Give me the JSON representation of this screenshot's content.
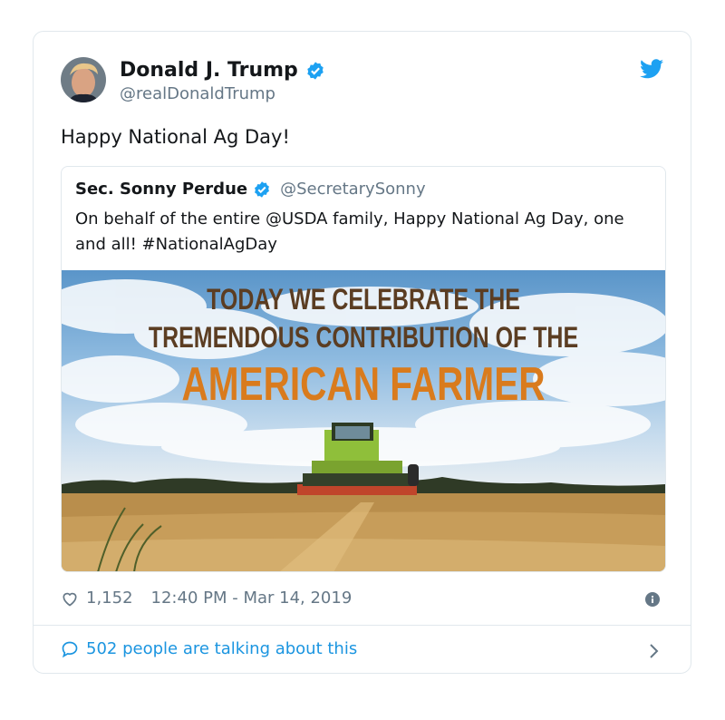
{
  "tweet": {
    "author_name": "Donald J. Trump",
    "author_handle": "@realDonaldTrump",
    "text": "Happy National Ag Day!",
    "likes": "1,152",
    "timestamp": "12:40 PM - Mar 14, 2019",
    "talking": "502 people are talking about this"
  },
  "quote": {
    "author_name": "Sec. Sonny Perdue",
    "author_handle": "@SecretarySonny",
    "text": "On behalf of the entire @USDA family, Happy National Ag Day, one and all! #NationalAgDay",
    "image_lines": [
      "TODAY WE CELEBRATE THE",
      "TREMENDOUS CONTRIBUTION OF THE",
      "AMERICAN FARMER"
    ]
  },
  "icons": {
    "verified": "verified-badge-icon",
    "bird": "twitter-bird-icon",
    "heart": "heart-icon",
    "info": "info-icon",
    "bubble": "speech-bubble-icon",
    "chevron": "chevron-right-icon"
  },
  "colors": {
    "twitter_blue": "#1da1f2",
    "link_blue": "#1b95e0",
    "muted_text": "#657786",
    "headline_brown": "#5b3d22",
    "headline_orange": "#d97b1d"
  }
}
